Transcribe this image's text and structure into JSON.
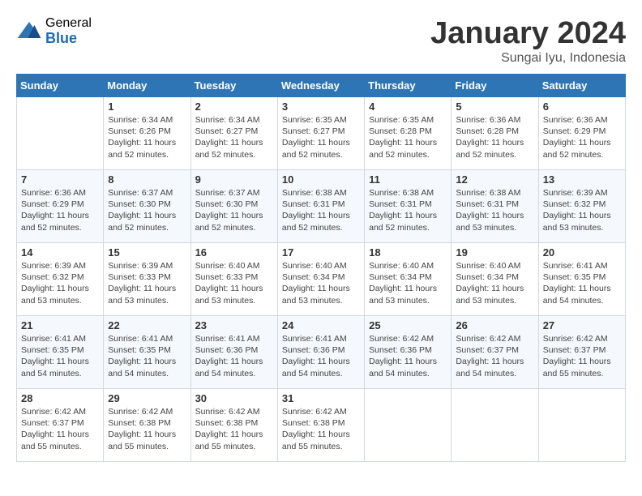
{
  "logo": {
    "general": "General",
    "blue": "Blue"
  },
  "title": "January 2024",
  "location": "Sungai Iyu, Indonesia",
  "days_of_week": [
    "Sunday",
    "Monday",
    "Tuesday",
    "Wednesday",
    "Thursday",
    "Friday",
    "Saturday"
  ],
  "weeks": [
    [
      {
        "day": "",
        "info": ""
      },
      {
        "day": "1",
        "info": "Sunrise: 6:34 AM\nSunset: 6:26 PM\nDaylight: 11 hours\nand 52 minutes."
      },
      {
        "day": "2",
        "info": "Sunrise: 6:34 AM\nSunset: 6:27 PM\nDaylight: 11 hours\nand 52 minutes."
      },
      {
        "day": "3",
        "info": "Sunrise: 6:35 AM\nSunset: 6:27 PM\nDaylight: 11 hours\nand 52 minutes."
      },
      {
        "day": "4",
        "info": "Sunrise: 6:35 AM\nSunset: 6:28 PM\nDaylight: 11 hours\nand 52 minutes."
      },
      {
        "day": "5",
        "info": "Sunrise: 6:36 AM\nSunset: 6:28 PM\nDaylight: 11 hours\nand 52 minutes."
      },
      {
        "day": "6",
        "info": "Sunrise: 6:36 AM\nSunset: 6:29 PM\nDaylight: 11 hours\nand 52 minutes."
      }
    ],
    [
      {
        "day": "7",
        "info": "Sunrise: 6:36 AM\nSunset: 6:29 PM\nDaylight: 11 hours\nand 52 minutes."
      },
      {
        "day": "8",
        "info": "Sunrise: 6:37 AM\nSunset: 6:30 PM\nDaylight: 11 hours\nand 52 minutes."
      },
      {
        "day": "9",
        "info": "Sunrise: 6:37 AM\nSunset: 6:30 PM\nDaylight: 11 hours\nand 52 minutes."
      },
      {
        "day": "10",
        "info": "Sunrise: 6:38 AM\nSunset: 6:31 PM\nDaylight: 11 hours\nand 52 minutes."
      },
      {
        "day": "11",
        "info": "Sunrise: 6:38 AM\nSunset: 6:31 PM\nDaylight: 11 hours\nand 52 minutes."
      },
      {
        "day": "12",
        "info": "Sunrise: 6:38 AM\nSunset: 6:31 PM\nDaylight: 11 hours\nand 53 minutes."
      },
      {
        "day": "13",
        "info": "Sunrise: 6:39 AM\nSunset: 6:32 PM\nDaylight: 11 hours\nand 53 minutes."
      }
    ],
    [
      {
        "day": "14",
        "info": "Sunrise: 6:39 AM\nSunset: 6:32 PM\nDaylight: 11 hours\nand 53 minutes."
      },
      {
        "day": "15",
        "info": "Sunrise: 6:39 AM\nSunset: 6:33 PM\nDaylight: 11 hours\nand 53 minutes."
      },
      {
        "day": "16",
        "info": "Sunrise: 6:40 AM\nSunset: 6:33 PM\nDaylight: 11 hours\nand 53 minutes."
      },
      {
        "day": "17",
        "info": "Sunrise: 6:40 AM\nSunset: 6:34 PM\nDaylight: 11 hours\nand 53 minutes."
      },
      {
        "day": "18",
        "info": "Sunrise: 6:40 AM\nSunset: 6:34 PM\nDaylight: 11 hours\nand 53 minutes."
      },
      {
        "day": "19",
        "info": "Sunrise: 6:40 AM\nSunset: 6:34 PM\nDaylight: 11 hours\nand 53 minutes."
      },
      {
        "day": "20",
        "info": "Sunrise: 6:41 AM\nSunset: 6:35 PM\nDaylight: 11 hours\nand 54 minutes."
      }
    ],
    [
      {
        "day": "21",
        "info": "Sunrise: 6:41 AM\nSunset: 6:35 PM\nDaylight: 11 hours\nand 54 minutes."
      },
      {
        "day": "22",
        "info": "Sunrise: 6:41 AM\nSunset: 6:35 PM\nDaylight: 11 hours\nand 54 minutes."
      },
      {
        "day": "23",
        "info": "Sunrise: 6:41 AM\nSunset: 6:36 PM\nDaylight: 11 hours\nand 54 minutes."
      },
      {
        "day": "24",
        "info": "Sunrise: 6:41 AM\nSunset: 6:36 PM\nDaylight: 11 hours\nand 54 minutes."
      },
      {
        "day": "25",
        "info": "Sunrise: 6:42 AM\nSunset: 6:36 PM\nDaylight: 11 hours\nand 54 minutes."
      },
      {
        "day": "26",
        "info": "Sunrise: 6:42 AM\nSunset: 6:37 PM\nDaylight: 11 hours\nand 54 minutes."
      },
      {
        "day": "27",
        "info": "Sunrise: 6:42 AM\nSunset: 6:37 PM\nDaylight: 11 hours\nand 55 minutes."
      }
    ],
    [
      {
        "day": "28",
        "info": "Sunrise: 6:42 AM\nSunset: 6:37 PM\nDaylight: 11 hours\nand 55 minutes."
      },
      {
        "day": "29",
        "info": "Sunrise: 6:42 AM\nSunset: 6:38 PM\nDaylight: 11 hours\nand 55 minutes."
      },
      {
        "day": "30",
        "info": "Sunrise: 6:42 AM\nSunset: 6:38 PM\nDaylight: 11 hours\nand 55 minutes."
      },
      {
        "day": "31",
        "info": "Sunrise: 6:42 AM\nSunset: 6:38 PM\nDaylight: 11 hours\nand 55 minutes."
      },
      {
        "day": "",
        "info": ""
      },
      {
        "day": "",
        "info": ""
      },
      {
        "day": "",
        "info": ""
      }
    ]
  ]
}
